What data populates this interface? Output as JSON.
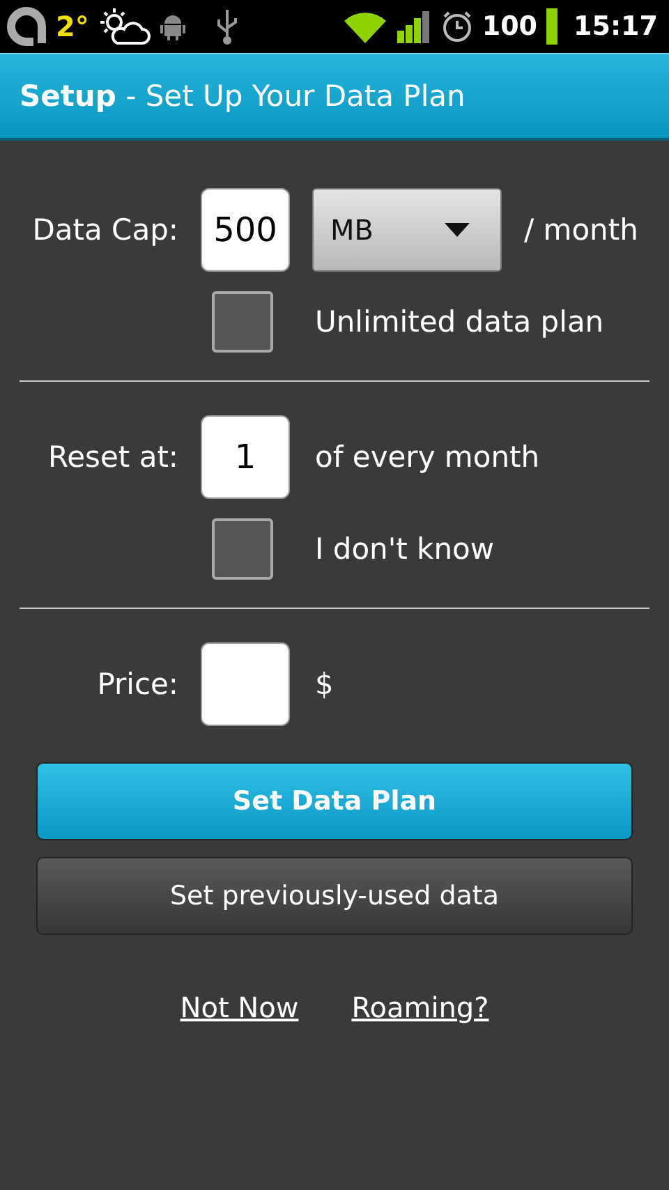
{
  "status_bar": {
    "temperature": "2°",
    "battery": "100",
    "time": "15:17"
  },
  "title": "**Setup** - Set Up Your Data Plan",
  "data_cap": {
    "label": "Data Cap:",
    "value": "500",
    "unit": "MB",
    "suffix": "/ month"
  },
  "unlimited": {
    "label": "Unlimited data plan",
    "checked": false
  },
  "reset": {
    "label": "Reset at:",
    "value": "1",
    "suffix": "of every month"
  },
  "unknown": {
    "label": "I don't know",
    "checked": false
  },
  "price": {
    "label": "Price:",
    "currency": "$"
  },
  "buttons": [
    {
      "label": "Set Data Plan",
      "kind": "primary"
    },
    {
      "label": "Set previously-used data",
      "kind": "secondary"
    }
  ],
  "links": [
    "Not Now",
    "Roaming?"
  ]
}
